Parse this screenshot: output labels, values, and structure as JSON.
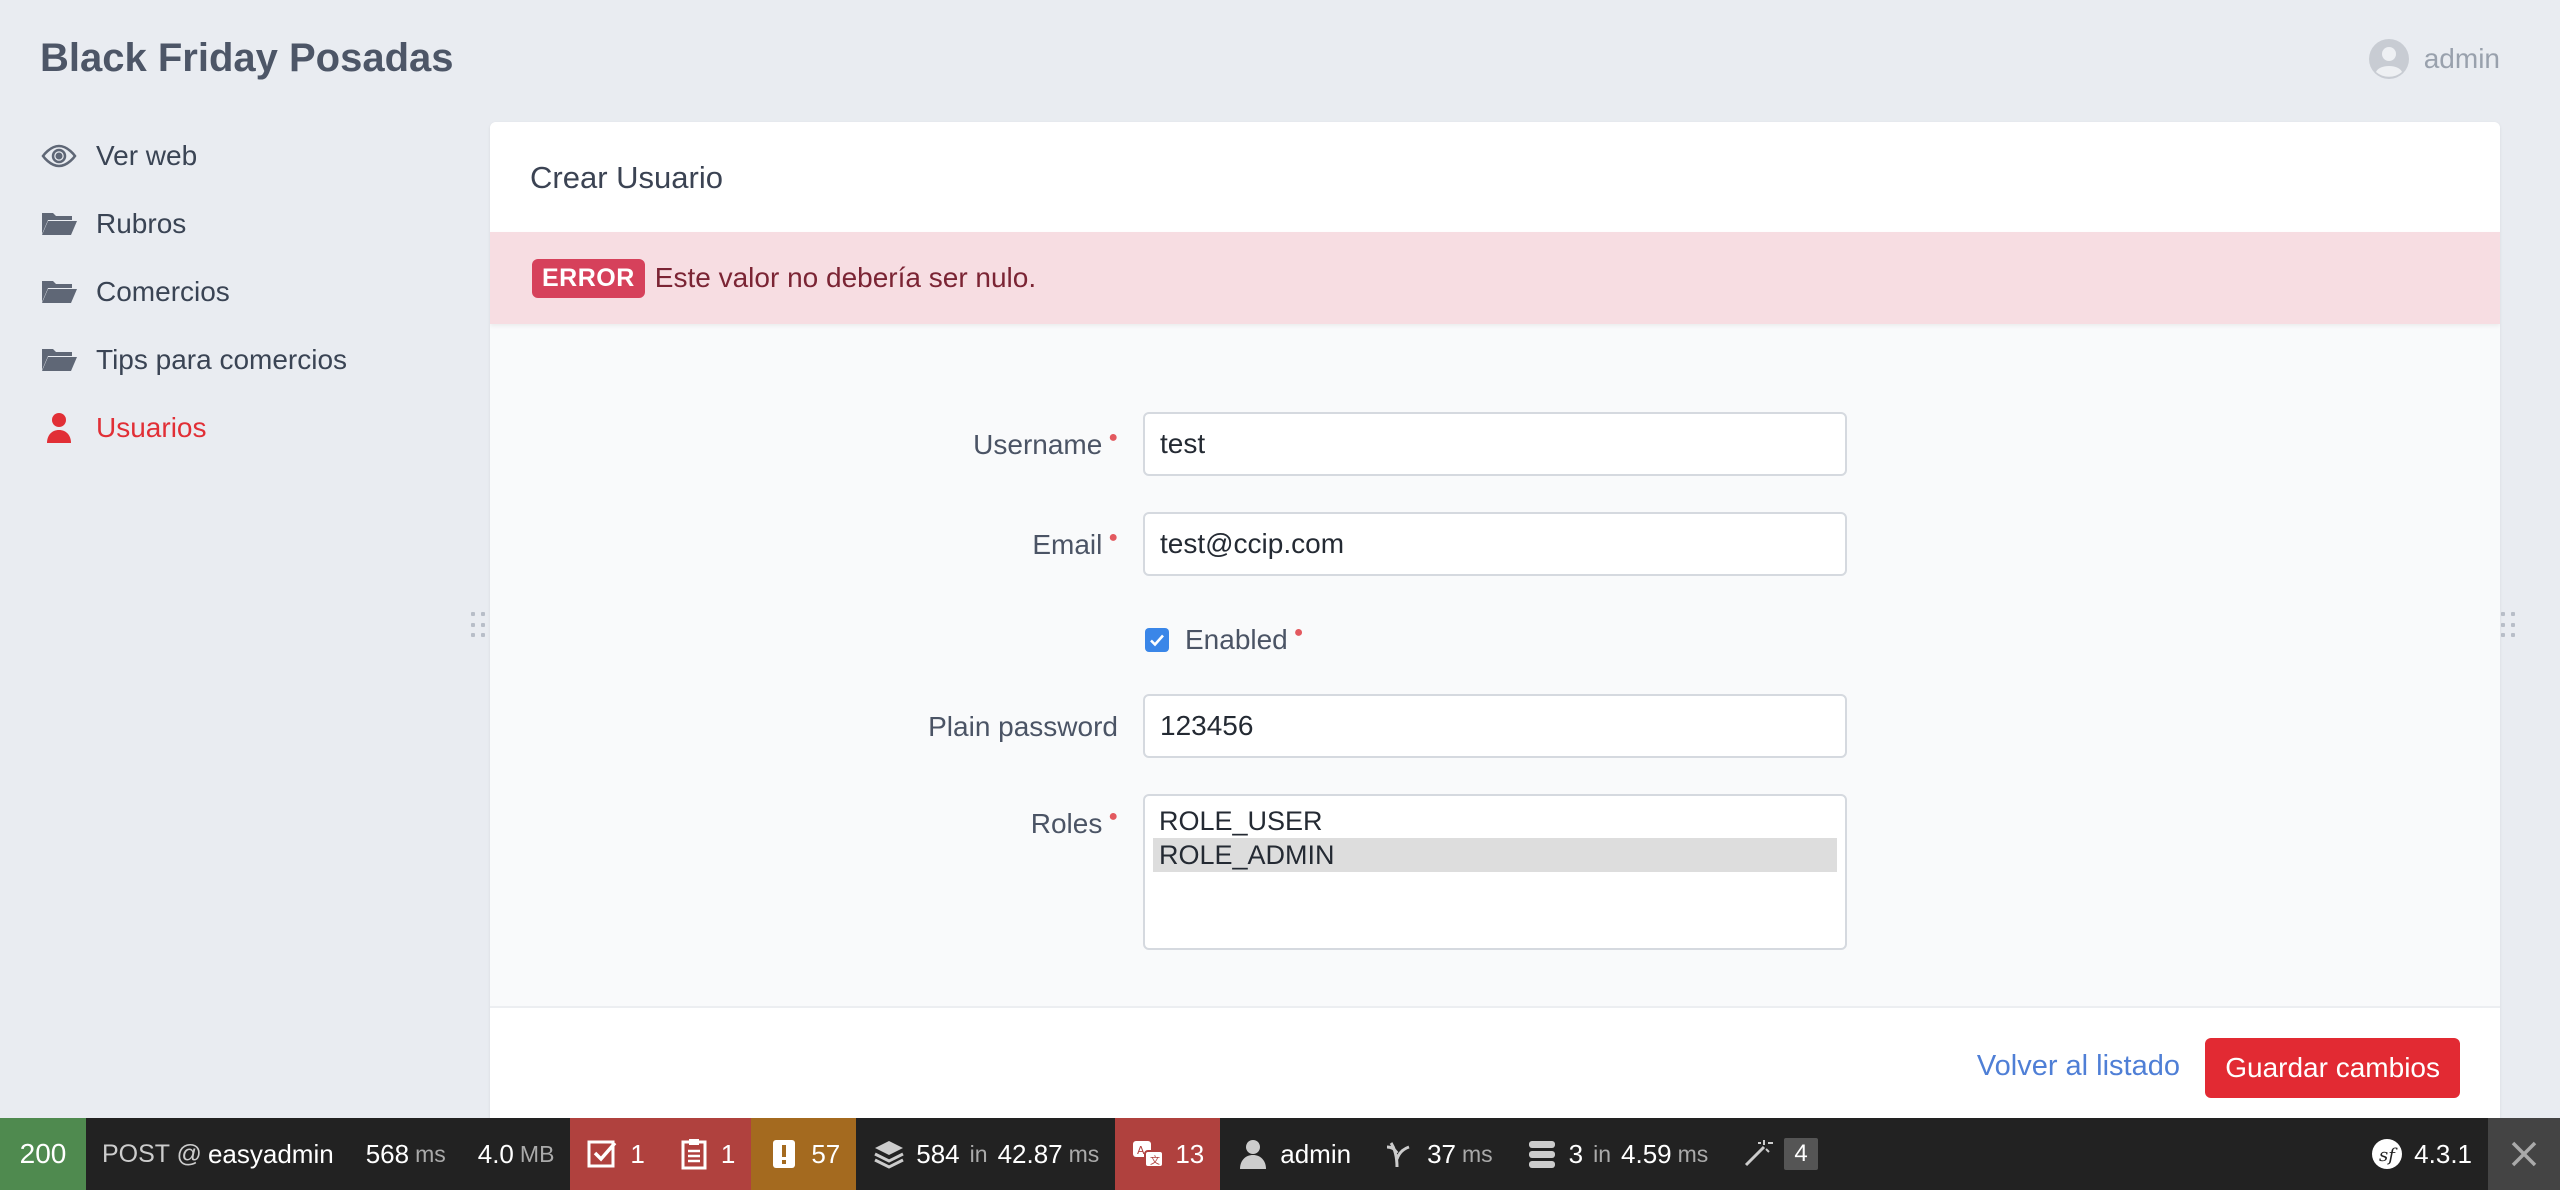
{
  "app": {
    "brand": "Black Friday Posadas",
    "user": "admin"
  },
  "sidebar": {
    "items": [
      {
        "label": "Ver web",
        "icon": "eye-icon",
        "active": false
      },
      {
        "label": "Rubros",
        "icon": "folder-icon",
        "active": false
      },
      {
        "label": "Comercios",
        "icon": "folder-icon",
        "active": false
      },
      {
        "label": "Tips para comercios",
        "icon": "folder-icon",
        "active": false
      },
      {
        "label": "Usuarios",
        "icon": "user-icon",
        "active": true
      }
    ]
  },
  "page": {
    "title": "Crear Usuario",
    "alert": {
      "badge": "ERROR",
      "message": "Este valor no debería ser nulo."
    }
  },
  "form": {
    "username": {
      "label": "Username",
      "value": "test",
      "required": true
    },
    "email": {
      "label": "Email",
      "value": "test@ccip.com",
      "required": true
    },
    "enabled": {
      "label": "Enabled",
      "checked": true,
      "required": true
    },
    "plain_password": {
      "label": "Plain password",
      "value": "123456",
      "required": false
    },
    "roles": {
      "label": "Roles",
      "required": true,
      "options": [
        {
          "label": "ROLE_USER",
          "selected": false
        },
        {
          "label": "ROLE_ADMIN",
          "selected": true
        }
      ]
    }
  },
  "footer": {
    "back_label": "Volver al listado",
    "save_label": "Guardar cambios"
  },
  "debug_toolbar": {
    "status": "200",
    "method": "POST @",
    "route": "easyadmin",
    "time_value": "568",
    "time_unit": "ms",
    "memory_value": "4.0",
    "memory_unit": "MB",
    "forms_count": "1",
    "logs_count": "1",
    "warnings_count": "57",
    "cache_calls": "584",
    "cache_in": "in",
    "cache_time": "42.87",
    "cache_unit": "ms",
    "translation_count": "13",
    "security_user": "admin",
    "twig_time": "37",
    "twig_unit": "ms",
    "db_queries": "3",
    "db_in": "in",
    "db_time": "4.59",
    "db_unit": "ms",
    "config_badge": "4",
    "symfony_version": "4.3.1"
  },
  "colors": {
    "accent": "#e12f36",
    "link": "#4f7fd6",
    "alert_bg": "#f7dde2",
    "error_badge": "#d6415b"
  }
}
